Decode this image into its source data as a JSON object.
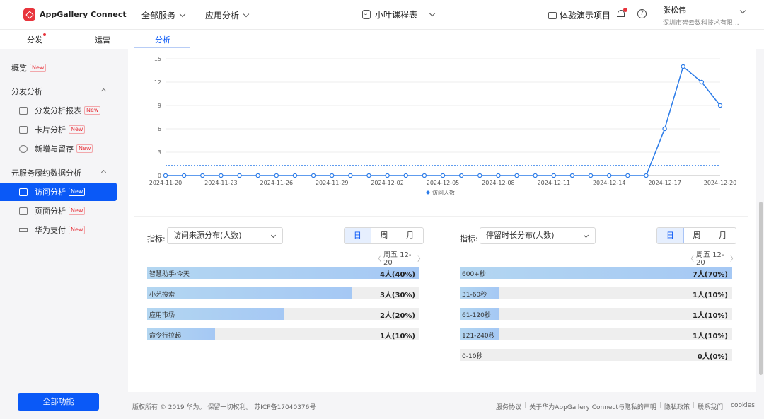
{
  "header": {
    "logo_text": "AppGallery Connect",
    "nav": [
      "全部服务",
      "应用分析"
    ],
    "app_name": "小叶课程表",
    "project": "体验演示项目",
    "user_name": "张松伟",
    "user_org": "深圳市智云数科技术有限..."
  },
  "subtabs": [
    "分发",
    "运营",
    "分析"
  ],
  "sidebar": {
    "overview": "概览",
    "new_tag": "New",
    "group1": "分发分析",
    "group1_items": [
      "分发分析报表",
      "卡片分析",
      "新增与留存"
    ],
    "group2": "元服务履约数据分析",
    "group2_items": [
      "访问分析",
      "页面分析",
      "华为支付"
    ],
    "all_button": "全部功能"
  },
  "chart_data": {
    "type": "line",
    "x": [
      "2024-11-20",
      "2024-11-21",
      "2024-11-22",
      "2024-11-23",
      "2024-11-24",
      "2024-11-25",
      "2024-11-26",
      "2024-11-27",
      "2024-11-28",
      "2024-11-29",
      "2024-11-30",
      "2024-12-01",
      "2024-12-02",
      "2024-12-03",
      "2024-12-04",
      "2024-12-05",
      "2024-12-06",
      "2024-12-07",
      "2024-12-08",
      "2024-12-09",
      "2024-12-10",
      "2024-12-11",
      "2024-12-12",
      "2024-12-13",
      "2024-12-14",
      "2024-12-15",
      "2024-12-16",
      "2024-12-17",
      "2024-12-18",
      "2024-12-19",
      "2024-12-20"
    ],
    "x_ticks": [
      "2024-11-20",
      "2024-11-23",
      "2024-11-26",
      "2024-11-29",
      "2024-12-02",
      "2024-12-05",
      "2024-12-08",
      "2024-12-11",
      "2024-12-14",
      "2024-12-17",
      "2024-12-20"
    ],
    "series": [
      {
        "name": "访问人数",
        "values": [
          0,
          0,
          0,
          0,
          0,
          0,
          0,
          0,
          0,
          0,
          0,
          0,
          0,
          0,
          0,
          0,
          0,
          0,
          0,
          0,
          0,
          0,
          0,
          0,
          0,
          0,
          0,
          6,
          14,
          12,
          9
        ]
      }
    ],
    "y_ticks": [
      0,
      3,
      6,
      9,
      12,
      15
    ],
    "ylim": [
      0,
      15
    ],
    "avg_line": 1.3,
    "color": "#2b7be8"
  },
  "left_panel": {
    "metric_label": "指标:",
    "metric_value": "访问来源分布(人数)",
    "periods": [
      "日",
      "周",
      "月"
    ],
    "date": "周五 12-20",
    "rows": [
      {
        "label": "智慧助手·今天",
        "value": "4人(40%)",
        "fraction": 1.0
      },
      {
        "label": "小艺搜索",
        "value": "3人(30%)",
        "fraction": 0.75
      },
      {
        "label": "应用市场",
        "value": "2人(20%)",
        "fraction": 0.5
      },
      {
        "label": "命令行拉起",
        "value": "1人(10%)",
        "fraction": 0.25
      }
    ]
  },
  "right_panel": {
    "metric_label": "指标:",
    "metric_value": "停留时长分布(人数)",
    "periods": [
      "日",
      "周",
      "月"
    ],
    "date": "周五 12-20",
    "rows": [
      {
        "label": "600+秒",
        "value": "7人(70%)",
        "fraction": 1.0
      },
      {
        "label": "31-60秒",
        "value": "1人(10%)",
        "fraction": 0.143
      },
      {
        "label": "61-120秒",
        "value": "1人(10%)",
        "fraction": 0.143
      },
      {
        "label": "121-240秒",
        "value": "1人(10%)",
        "fraction": 0.143
      },
      {
        "label": "0-10秒",
        "value": "0人(0%)",
        "fraction": 0
      }
    ]
  },
  "footer": {
    "copyright": "版权所有 © 2019 华为。 保留一切权利。 苏ICP备17040376号",
    "links": [
      "服务协议",
      "关于华为AppGallery Connect与隐私的声明",
      "隐私政策",
      "联系我们",
      "cookies"
    ]
  }
}
